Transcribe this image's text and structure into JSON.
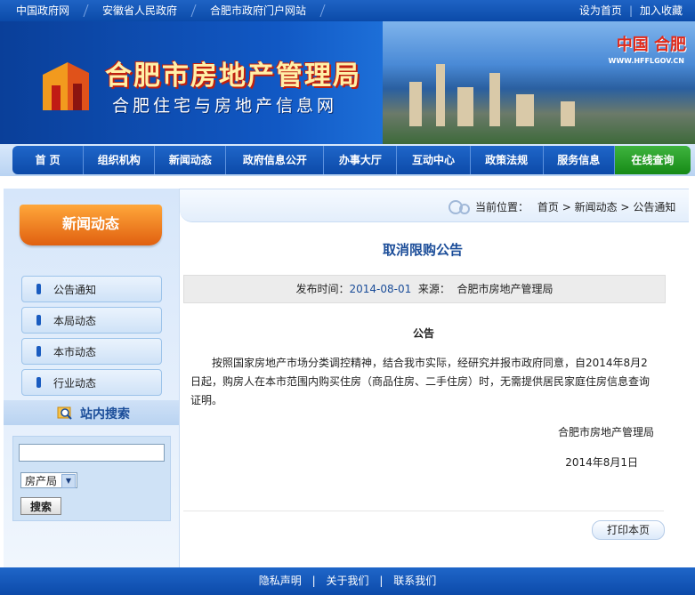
{
  "topbar": {
    "links": [
      "中国政府网",
      "安徽省人民政府",
      "合肥市政府门户网站"
    ],
    "right": [
      "设为首页",
      "加入收藏"
    ],
    "right_sep": "|"
  },
  "banner": {
    "title": "合肥市房地产管理局",
    "subtitle": "合肥住宅与房地产信息网",
    "corner_text": "中国 合肥",
    "url": "WWW.HFFLGOV.CN"
  },
  "nav": {
    "items": [
      "首 页",
      "组织机构",
      "新闻动态",
      "政府信息公开",
      "办事大厅",
      "互动中心",
      "政策法规",
      "服务信息",
      "在线查询"
    ]
  },
  "sidebar": {
    "heading": "新闻动态",
    "menu": [
      "公告通知",
      "本局动态",
      "本市动态",
      "行业动态"
    ],
    "search_heading": "站内搜索",
    "search_input_value": "",
    "search_select_value": "房产局",
    "search_button": "搜索"
  },
  "breadcrumb": {
    "label": "当前位置：",
    "items": [
      "首页",
      "新闻动态",
      "公告通知"
    ],
    "sep": ">"
  },
  "article": {
    "title": "取消限购公告",
    "date_label": "发布时间：",
    "date": "2014-08-01",
    "source_label": "来源：",
    "source": "合肥市房地产管理局",
    "body_title": "公告",
    "body": "按照国家房地产市场分类调控精神，结合我市实际，经研究并报市政府同意，自2014年8月2日起，购房人在本市范围内购买住房（商品住房、二手住房）时，无需提供居民家庭住房信息查询证明。",
    "signature": "合肥市房地产管理局",
    "sign_date": "2014年8月1日",
    "print_button": "打印本页"
  },
  "footer": {
    "links": [
      "隐私声明",
      "关于我们",
      "联系我们"
    ],
    "sep": "|"
  },
  "colors": {
    "primary_blue": "#0c4aa9",
    "accent_orange": "#e06010",
    "active_green": "#168a16",
    "title_blue": "#1b4d99"
  }
}
